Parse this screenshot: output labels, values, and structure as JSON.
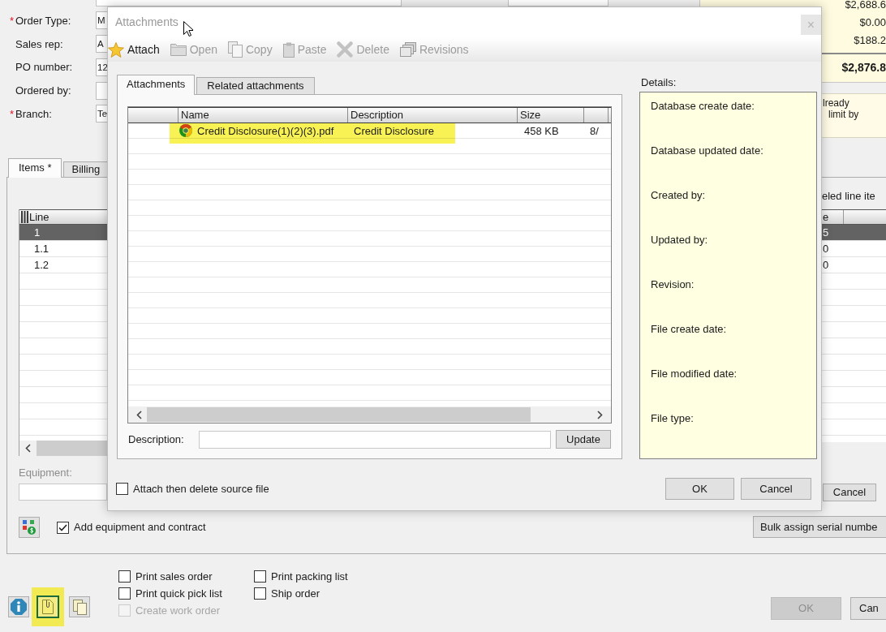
{
  "order_form": {
    "fields": [
      {
        "marker": "*",
        "label": "Order Type:",
        "value": "M"
      },
      {
        "label": "Sales rep:",
        "value": "A"
      },
      {
        "label": "PO number:",
        "value": "12"
      },
      {
        "label": "Ordered by:"
      },
      {
        "marker": "*",
        "label": "Branch:",
        "value": "Te"
      }
    ]
  },
  "summary": {
    "amounts": [
      "$2,688.6",
      "$0.00",
      "$188.2"
    ],
    "total": "$2,876.8",
    "note": [
      "lready",
      "limit by"
    ]
  },
  "item_tabs": [
    {
      "label": "Items *",
      "selected": true
    },
    {
      "label": "Billing",
      "selected": false
    }
  ],
  "lines_table": {
    "column": "Line",
    "rows": [
      {
        "line": "1",
        "selected": true
      },
      {
        "line": "1.1",
        "selected": false
      },
      {
        "line": "1.2",
        "selected": false
      }
    ]
  },
  "equipment": {
    "label": "Equipment:"
  },
  "add_equipment": {
    "label": "Add equipment and contract",
    "checked": true
  },
  "side_list": {
    "caption": "eled line ite",
    "column": "e",
    "rows": [
      {
        "value": "5",
        "selected": true
      },
      {
        "value": "0",
        "selected": false
      },
      {
        "value": "0",
        "selected": false
      }
    ],
    "cancel_button": "Cancel"
  },
  "bulk_button": "Bulk assign serial numbe",
  "footer": {
    "icon_buttons": [
      {
        "kind": "info",
        "highlighted": false
      },
      {
        "kind": "attachment",
        "highlighted": true
      },
      {
        "kind": "copy",
        "highlighted": false
      }
    ],
    "checkbox_columns": [
      [
        {
          "label": "Print sales order",
          "checked": false,
          "disabled": false
        },
        {
          "label": "Print quick pick list",
          "checked": false,
          "disabled": false
        },
        {
          "label": "Create work order",
          "checked": false,
          "disabled": true
        }
      ],
      [
        {
          "label": "Print packing list",
          "checked": false,
          "disabled": false
        },
        {
          "label": "Ship order",
          "checked": false,
          "disabled": false
        }
      ]
    ],
    "buttons": [
      {
        "label": "OK",
        "disabled": true
      },
      {
        "label": "Can",
        "disabled": false
      }
    ]
  },
  "dialog": {
    "title": "Attachments",
    "close": "×",
    "toolbar": [
      {
        "kind": "attach",
        "label": "Attach",
        "disabled": false
      },
      {
        "kind": "open",
        "label": "Open",
        "disabled": true
      },
      {
        "kind": "copy",
        "label": "Copy",
        "disabled": true
      },
      {
        "kind": "paste",
        "label": "Paste",
        "disabled": true
      },
      {
        "kind": "delete",
        "label": "Delete",
        "disabled": true
      },
      {
        "kind": "revisions",
        "label": "Revisions",
        "disabled": true
      }
    ],
    "tabs": [
      {
        "label": "Attachments",
        "selected": true
      },
      {
        "label": "Related attachments",
        "selected": false
      }
    ],
    "grid": {
      "columns": [
        "Name",
        "Description",
        "Size"
      ],
      "rows": [
        {
          "name": "Credit Disclosure(1)(2)(3).pdf",
          "description": "Credit Disclosure",
          "size": "458 KB",
          "column_5": "8/",
          "highlighted": true
        }
      ]
    },
    "description_label": "Description:",
    "update_button": "Update",
    "details": {
      "title": "Details:",
      "labels": [
        "Database create date:",
        "Database updated date:",
        "Created by:",
        "Updated by:",
        "Revision:",
        "File create date:",
        "File modified date:",
        "File type:"
      ]
    },
    "delete_source": {
      "label": "Attach then delete source file",
      "checked": false
    },
    "buttons": [
      "OK",
      "Cancel"
    ]
  }
}
